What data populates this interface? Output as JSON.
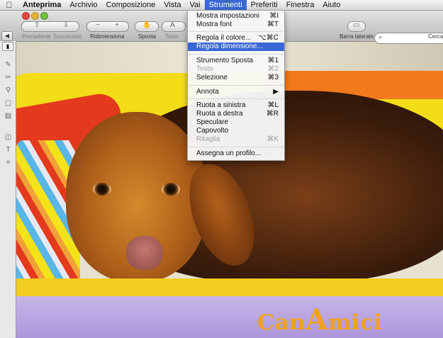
{
  "menubar": {
    "items": [
      {
        "label": "Anteprima"
      },
      {
        "label": "Archivio"
      },
      {
        "label": "Composizione"
      },
      {
        "label": "Vista"
      },
      {
        "label": "Vai"
      },
      {
        "label": "Strumenti"
      },
      {
        "label": "Preferiti"
      },
      {
        "label": "Finestra"
      },
      {
        "label": "Aiuto"
      }
    ]
  },
  "toolbar": {
    "prev_label": "Precedente",
    "next_label": "Successivo",
    "resize_label": "Ridimensiona",
    "move_label": "Sposta",
    "text_label": "Testo",
    "sidebar_label": "Barra laterale",
    "search_label": "Cerca"
  },
  "menu": {
    "items": [
      {
        "label": "Mostra impostazioni",
        "shortcut": "⌘I"
      },
      {
        "label": "Mostra font",
        "shortcut": "⌘T"
      },
      {
        "label": "Regola il colore...",
        "shortcut": "⌥⌘C"
      },
      {
        "label": "Regola dimensione...",
        "shortcut": ""
      },
      {
        "label": "Strumento Sposta",
        "shortcut": "⌘1"
      },
      {
        "label": "Testo",
        "shortcut": "⌘2"
      },
      {
        "label": "Selezione",
        "shortcut": "⌘3"
      },
      {
        "label": "Annota",
        "shortcut": "▶"
      },
      {
        "label": "Ruota a sinistra",
        "shortcut": "⌘L"
      },
      {
        "label": "Ruota a destra",
        "shortcut": "⌘R"
      },
      {
        "label": "Speculare",
        "shortcut": ""
      },
      {
        "label": "Capovolto",
        "shortcut": ""
      },
      {
        "label": "Ritaglia",
        "shortcut": "⌘K"
      },
      {
        "label": "Assegna un profilo...",
        "shortcut": ""
      }
    ]
  },
  "photo": {
    "logo_text": "CANAMICI"
  },
  "colors": {
    "menu_highlight": "#3a67d6"
  }
}
